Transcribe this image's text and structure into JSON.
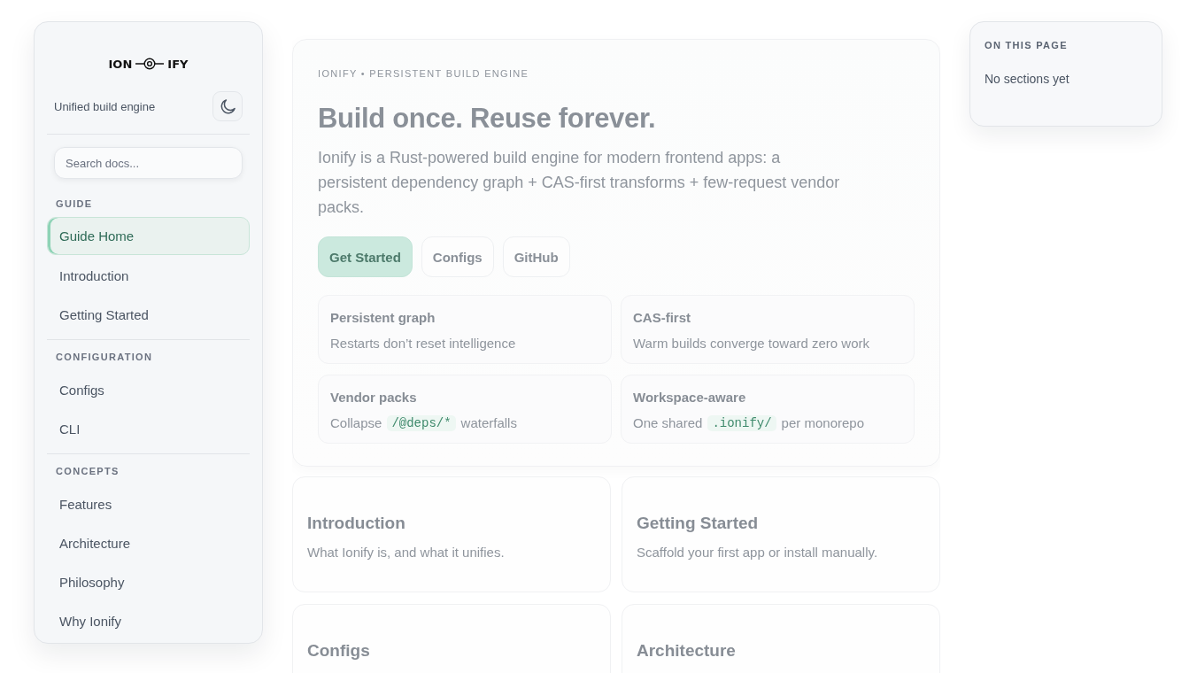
{
  "sidebar": {
    "logo": {
      "left": "ION",
      "right": "IFY"
    },
    "tagline": "Unified build engine",
    "search": {
      "placeholder": "Search docs..."
    },
    "sections": [
      {
        "heading": "GUIDE",
        "items": [
          {
            "label": "Guide Home",
            "selected": true
          },
          {
            "label": "Introduction",
            "selected": false
          },
          {
            "label": "Getting Started",
            "selected": false
          }
        ]
      },
      {
        "heading": "CONFIGURATION",
        "items": [
          {
            "label": "Configs",
            "selected": false
          },
          {
            "label": "CLI",
            "selected": false
          }
        ]
      },
      {
        "heading": "CONCEPTS",
        "items": [
          {
            "label": "Features",
            "selected": false
          },
          {
            "label": "Architecture",
            "selected": false
          },
          {
            "label": "Philosophy",
            "selected": false
          },
          {
            "label": "Why Ionify",
            "selected": false
          }
        ]
      }
    ]
  },
  "hero": {
    "eyebrow": "IONIFY • PERSISTENT BUILD ENGINE",
    "title": "Build once. Reuse forever.",
    "description": "Ionify is a Rust-powered build engine for modern frontend apps: a persistent dependency graph + CAS-first transforms + few-request vendor packs.",
    "buttons": [
      {
        "label": "Get Started",
        "kind": "primary"
      },
      {
        "label": "Configs",
        "kind": "secondary"
      },
      {
        "label": "GitHub",
        "kind": "secondary"
      }
    ],
    "features": [
      {
        "title": "Persistent graph",
        "description": [
          {
            "kind": "text",
            "text": "Restarts don’t reset intelligence"
          }
        ]
      },
      {
        "title": "CAS-first",
        "description": [
          {
            "kind": "text",
            "text": "Warm builds converge toward zero work"
          }
        ]
      },
      {
        "title": "Vendor packs",
        "description": [
          {
            "kind": "text",
            "text": "Collapse"
          },
          {
            "kind": "code",
            "text": "/@deps/*"
          },
          {
            "kind": "text",
            "text": "waterfalls"
          }
        ]
      },
      {
        "title": "Workspace-aware",
        "description": [
          {
            "kind": "text",
            "text": "One shared"
          },
          {
            "kind": "code",
            "text": ".ionify/"
          },
          {
            "kind": "text",
            "text": "per monorepo"
          }
        ]
      }
    ]
  },
  "doc_cards": [
    {
      "title": "Introduction",
      "description": "What Ionify is, and what it unifies."
    },
    {
      "title": "Getting Started",
      "description": "Scaffold your first app or install manually."
    },
    {
      "title": "Configs"
    },
    {
      "title": "Architecture"
    }
  ],
  "toc": {
    "heading": "ON THIS PAGE",
    "empty_text": "No sections yet"
  }
}
